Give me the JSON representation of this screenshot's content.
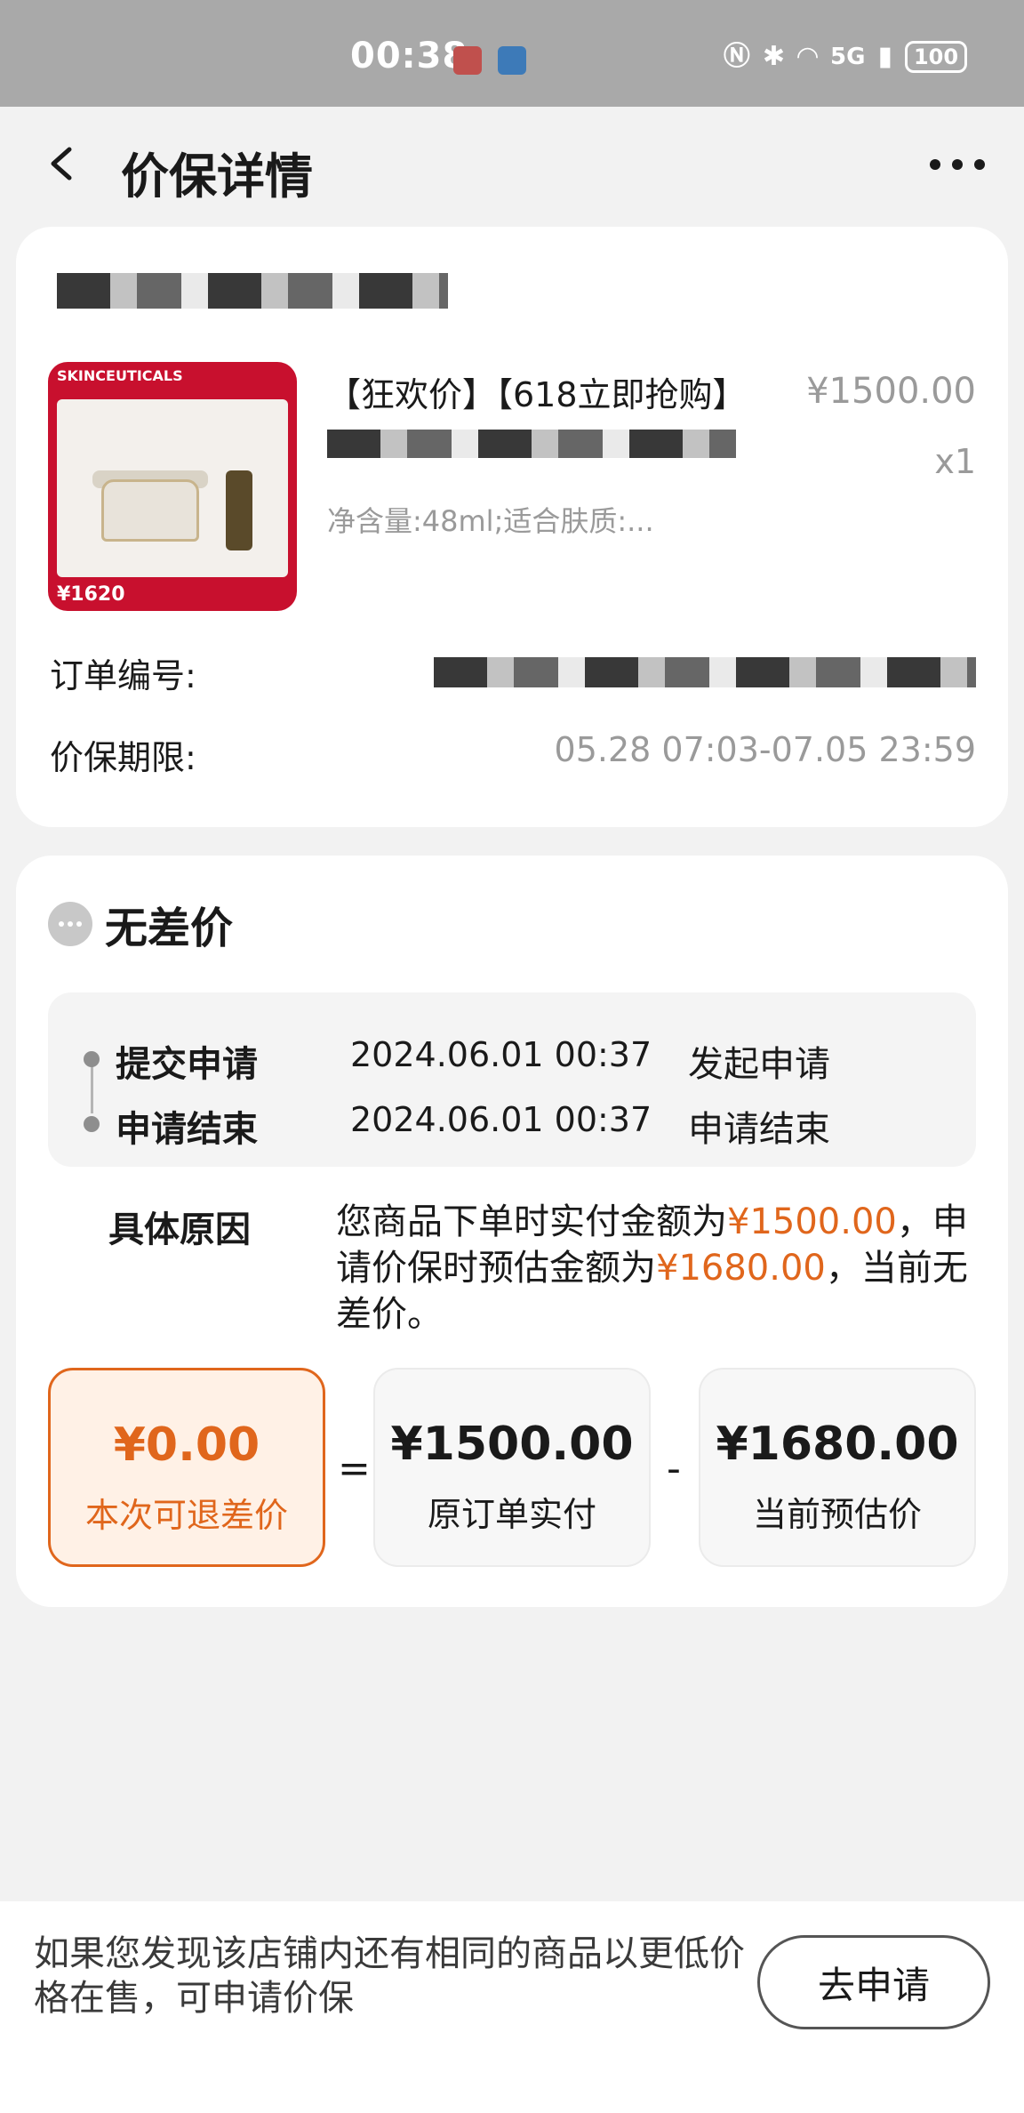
{
  "status_bar": {
    "time": "00:38",
    "network": "5G",
    "battery": "100"
  },
  "header": {
    "title": "价保详情"
  },
  "order": {
    "product_title": "【狂欢价】【618立即抢购】",
    "price": "¥1500.00",
    "quantity": "x1",
    "spec": "净含量:48ml;适合肤质:...",
    "image_brand": "SKINCEUTICALS",
    "image_price": "¥1620",
    "order_no_label": "订单编号:",
    "period_label": "价保期限:",
    "period_value": "05.28 07:03-07.05 23:59"
  },
  "status": {
    "title": "无差价",
    "timeline": [
      {
        "name": "提交申请",
        "time": "2024.06.01 00:37",
        "action": "发起申请"
      },
      {
        "name": "申请结束",
        "time": "2024.06.01 00:37",
        "action": "申请结束"
      }
    ],
    "reason_label": "具体原因",
    "reason_part1": "您商品下单时实付金额为",
    "reason_amount1": "¥1500.00",
    "reason_part2": "，申请价保时预估金额为",
    "reason_amount2": "¥1680.00",
    "reason_part3": "，当前无差价。",
    "calc": {
      "refund_amount": "¥0.00",
      "refund_label": "本次可退差价",
      "equals": "=",
      "paid_amount": "¥1500.00",
      "paid_label": "原订单实付",
      "minus": "-",
      "current_amount": "¥1680.00",
      "current_label": "当前预估价"
    }
  },
  "footer": {
    "text": "如果您发现该店铺内还有相同的商品以更低价格在售，可申请价保",
    "button": "去申请"
  },
  "colors": {
    "accent": "#e0661c",
    "status_bar_bg": "#a9a9a9",
    "page_bg": "#f2f2f2"
  }
}
